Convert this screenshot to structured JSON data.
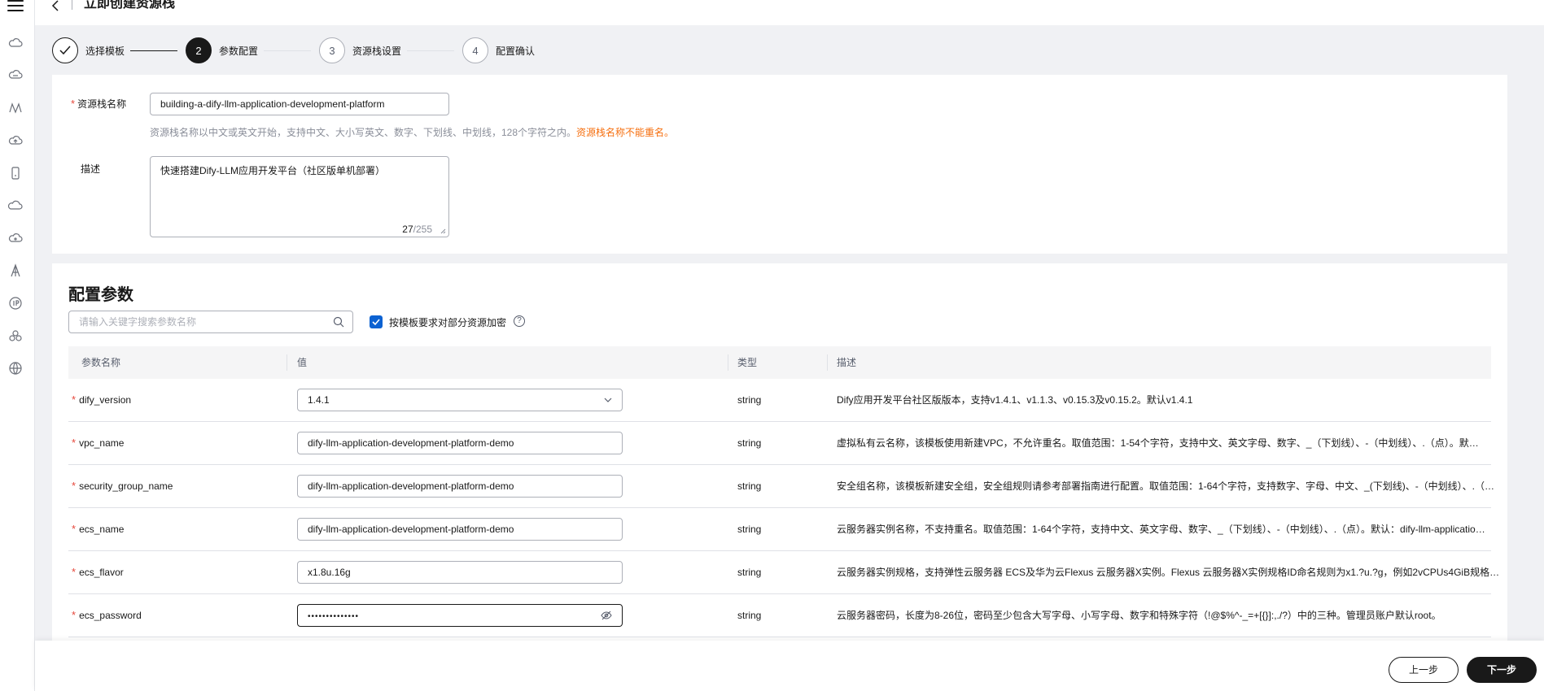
{
  "header": {
    "title": "立即创建资源栈",
    "back_icon": "chevron-left-icon"
  },
  "rail": {
    "icons": [
      "menu-icon",
      "cloud-icon",
      "cloud-server-icon",
      "network-icon",
      "cloud-upload-icon",
      "mobile-icon",
      "cloud-outline-icon",
      "cloud-alt-icon",
      "tower-icon",
      "ip-icon",
      "cluster-icon",
      "globe-icon"
    ]
  },
  "steps": [
    {
      "num": "",
      "label": "选择模板",
      "state": "done"
    },
    {
      "num": "2",
      "label": "参数配置",
      "state": "active"
    },
    {
      "num": "3",
      "label": "资源栈设置",
      "state": "todo"
    },
    {
      "num": "4",
      "label": "配置确认",
      "state": "todo"
    }
  ],
  "basic": {
    "name_label": "资源栈名称",
    "name_value": "building-a-dify-llm-application-development-platform",
    "name_hint": "资源栈名称以中文或英文开始，支持中文、大小写英文、数字、下划线、中划线，128个字符之内。",
    "name_hint_warn": "资源栈名称不能重名。",
    "desc_label": "描述",
    "desc_value": "快速搭建Dify-LLM应用开发平台（社区版单机部署）",
    "desc_count": "27",
    "desc_max": "/255"
  },
  "params": {
    "title": "配置参数",
    "search_placeholder": "请输入关键字搜索参数名称",
    "encrypt_label": "按模板要求对部分资源加密",
    "help_icon": "?",
    "columns": {
      "name": "参数名称",
      "value": "值",
      "type": "类型",
      "desc": "描述"
    },
    "rows": [
      {
        "name": "dify_version",
        "value": "1.4.1",
        "type": "string",
        "desc": "Dify应用开发平台社区版版本，支持v1.4.1、v1.1.3、v0.15.3及v0.15.2。默认v1.4.1"
      },
      {
        "name": "vpc_name",
        "value": "dify-llm-application-development-platform-demo",
        "type": "string",
        "desc": "虚拟私有云名称，该模板使用新建VPC，不允许重名。取值范围：1-54个字符，支持中文、英文字母、数字、_（下划线）、-（中划线）、.（点）。默…"
      },
      {
        "name": "security_group_name",
        "value": "dify-llm-application-development-platform-demo",
        "type": "string",
        "desc": "安全组名称，该模板新建安全组，安全组规则请参考部署指南进行配置。取值范围：1-64个字符，支持数字、字母、中文、_(下划线)、-（中划线）、.（…"
      },
      {
        "name": "ecs_name",
        "value": "dify-llm-application-development-platform-demo",
        "type": "string",
        "desc": "云服务器实例名称，不支持重名。取值范围：1-64个字符，支持中文、英文字母、数字、_（下划线）、-（中划线）、.（点）。默认：dify-llm-applicatio…"
      },
      {
        "name": "ecs_flavor",
        "value": "x1.8u.16g",
        "type": "string",
        "desc": "云服务器实例规格，支持弹性云服务器 ECS及华为云Flexus 云服务器X实例。Flexus 云服务器X实例规格ID命名规则为x1.?u.?g，例如2vCPUs4GiB规格…"
      },
      {
        "name": "ecs_password",
        "value": "••••••••••••••",
        "type": "string",
        "desc": "云服务器密码，长度为8-26位，密码至少包含大写字母、小写字母、数字和特殊字符（!@$%^-_=+[{}]:,./?）中的三种。管理员账户默认root。"
      }
    ]
  },
  "footer": {
    "prev": "上一步",
    "next": "下一步"
  }
}
